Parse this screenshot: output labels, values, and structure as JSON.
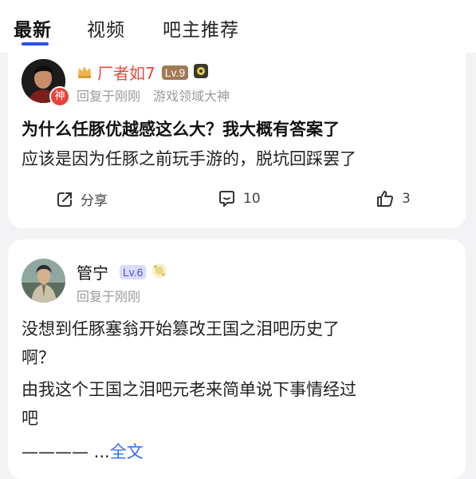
{
  "tabs": [
    {
      "label": "最新",
      "active": true
    },
    {
      "label": "视频",
      "active": false
    },
    {
      "label": "吧主推荐",
      "active": false
    }
  ],
  "posts": [
    {
      "username": "厂者如7",
      "level": "Lv.9",
      "god_tag": "神",
      "reply_time": "回复于刚刚",
      "title_tag": "游戏领域大神",
      "title": "为什么任豚优越感这么大？我大概有答案了",
      "excerpt": "应该是因为任豚之前玩手游的，脱坑回踩罢了",
      "actions": {
        "share": "分享",
        "comments": "10",
        "likes": "3"
      }
    },
    {
      "username": "管宁",
      "level": "Lv.6",
      "reply_time": "回复于刚刚",
      "body_lines": [
        "没想到任豚塞翁开始篡改王国之泪吧历史了",
        "啊？",
        "由我这个王国之泪吧元老来简单说下事情经过",
        "吧"
      ],
      "truncate_line": "———— ...",
      "more_link": "全文"
    }
  ],
  "colors": {
    "accent": "#2f4cf5",
    "username_red": "#e8483b",
    "lv9_bg": "#a07a55",
    "lv6_bg": "#d9dcfb",
    "lv6_text": "#4a55d8",
    "link": "#2f6bf5"
  },
  "icons": [
    "crown-icon",
    "settings-badge-icon",
    "share-icon",
    "comment-icon",
    "like-icon",
    "medal-icon"
  ]
}
